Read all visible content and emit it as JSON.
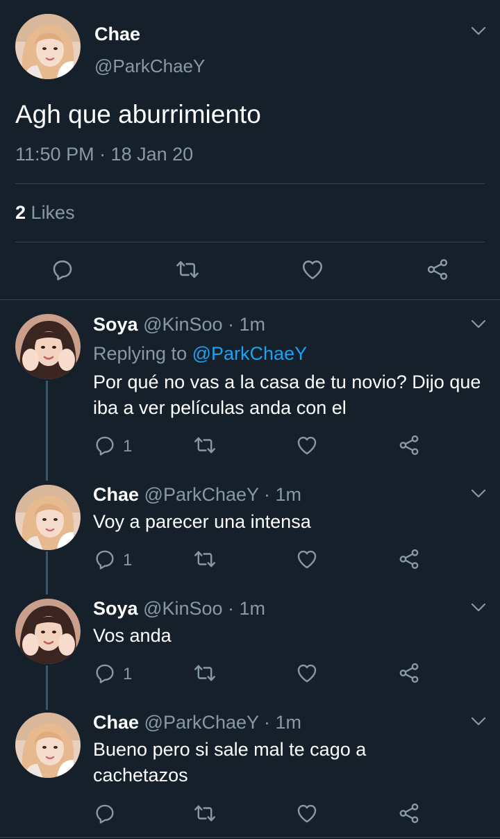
{
  "main_tweet": {
    "name": "Chae",
    "handle": "@ParkChaeY",
    "text": "Agh que aburrimiento",
    "timestamp": "11:50 PM · 18 Jan 20",
    "likes_count": "2",
    "likes_label": "Likes"
  },
  "replies": [
    {
      "name": "Soya",
      "meta": "@KinSoo · 1m",
      "replying_prefix": "Replying to",
      "replying_to": "@ParkChaeY",
      "text": "Por qué no vas a la casa de tu novio? Dijo que iba a ver películas anda con el",
      "reply_count": "1"
    },
    {
      "name": "Chae",
      "meta": "@ParkChaeY · 1m",
      "text": "Voy a parecer una intensa",
      "reply_count": "1"
    },
    {
      "name": "Soya",
      "meta": "@KinSoo · 1m",
      "text": "Vos anda",
      "reply_count": "1"
    },
    {
      "name": "Chae",
      "meta": "@ParkChaeY · 1m",
      "text": "Bueno pero si sale mal te cago a cachetazos",
      "reply_count": ""
    }
  ],
  "colors": {
    "background": "#15202b",
    "muted": "#8899a6",
    "link": "#1da1f2",
    "divider": "#38444d"
  },
  "icons": [
    "chevron-down-icon",
    "reply-icon",
    "retweet-icon",
    "like-icon",
    "share-icon"
  ]
}
